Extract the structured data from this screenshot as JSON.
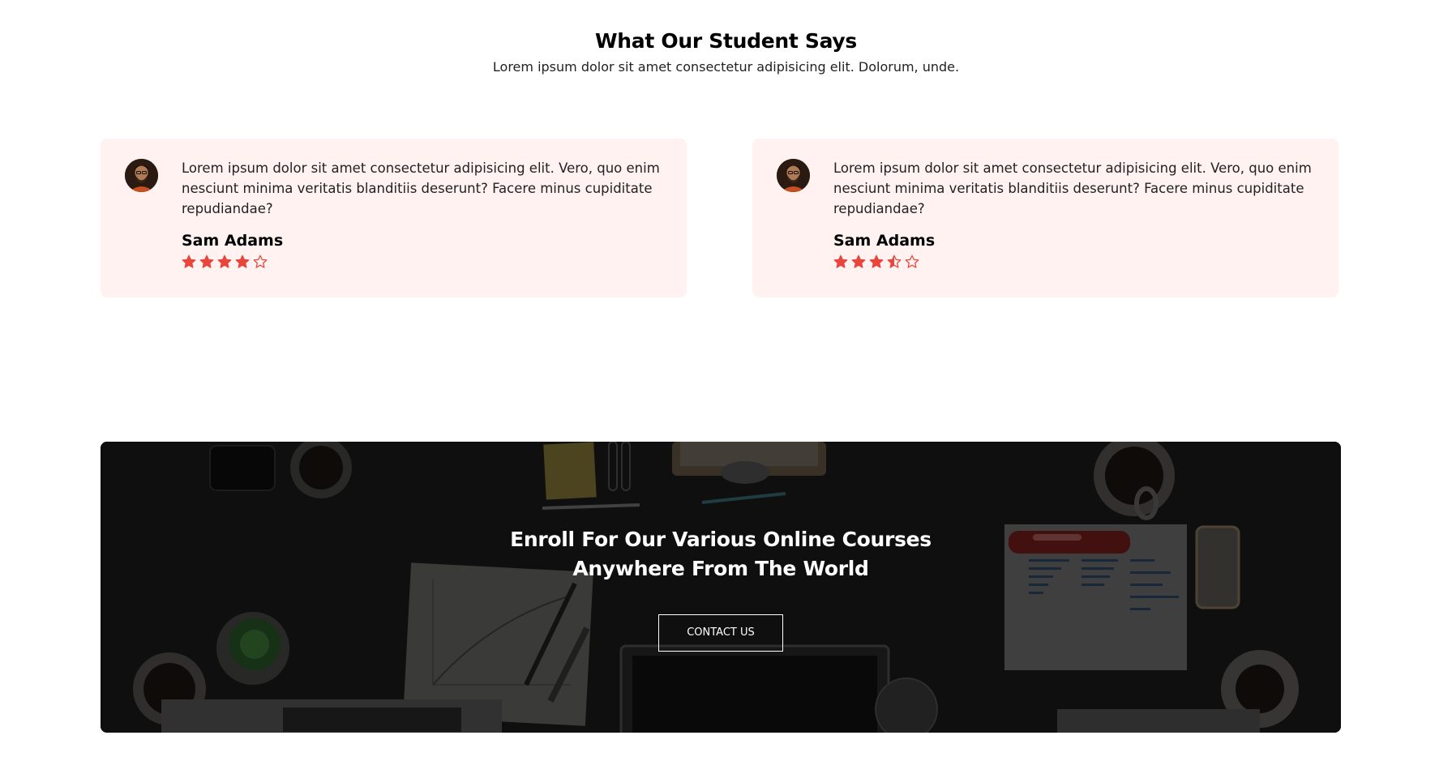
{
  "testimonials": {
    "title": "What Our Student Says",
    "subtitle": "Lorem ipsum dolor sit amet consectetur adipisicing elit. Dolorum, unde.",
    "cards": [
      {
        "text": "Lorem ipsum dolor sit amet consectetur adipisicing elit. Vero, quo enim nesciunt minima veritatis blanditiis deserunt? Facere minus cupiditate repudiandae?",
        "name": "Sam Adams",
        "rating": 4,
        "rating_max": 5,
        "avatar_icon": "user-avatar"
      },
      {
        "text": "Lorem ipsum dolor sit amet consectetur adipisicing elit. Vero, quo enim nesciunt minima veritatis blanditiis deserunt? Facere minus cupiditate repudiandae?",
        "name": "Sam Adams",
        "rating": 3.5,
        "rating_max": 5,
        "avatar_icon": "user-avatar"
      }
    ],
    "card_background": "#fff2f1",
    "star_color": "#e8453c"
  },
  "banner": {
    "title_line1": "Enroll For Our Various Online Courses",
    "title_line2": "Anywhere From The World",
    "button_label": "CONTACT US",
    "background_icon": "desk-workspace-photo"
  }
}
